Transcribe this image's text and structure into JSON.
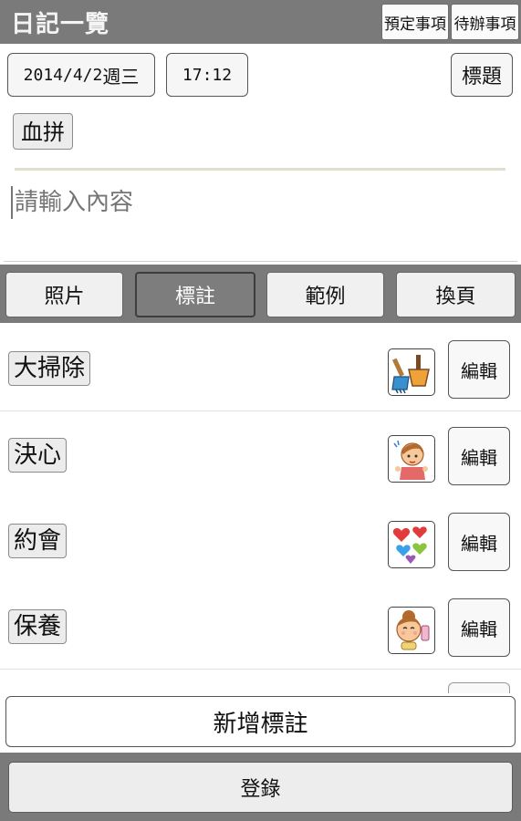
{
  "header": {
    "title": "日記一覽",
    "buttons": [
      "預定事項",
      "待辦事項"
    ]
  },
  "entry": {
    "date": "2014/4/2",
    "weekday": "週三",
    "time": "17:12",
    "title_button": "標題",
    "tag": "血拼",
    "content_placeholder": "請輸入內容"
  },
  "tabs": [
    {
      "label": "照片",
      "active": false
    },
    {
      "label": "標註",
      "active": true
    },
    {
      "label": "範例",
      "active": false
    },
    {
      "label": "換頁",
      "active": false
    }
  ],
  "stamps": [
    {
      "label": "大掃除",
      "icon": "broom-dustpan-icon",
      "edit_label": "編輯"
    },
    {
      "label": "決心",
      "icon": "determined-girl-icon",
      "edit_label": "編輯"
    },
    {
      "label": "約會",
      "icon": "hearts-icon",
      "edit_label": "編輯"
    },
    {
      "label": "保養",
      "icon": "skincare-girl-icon",
      "edit_label": "編輯"
    }
  ],
  "add_button": "新增標註",
  "submit_button": "登錄"
}
